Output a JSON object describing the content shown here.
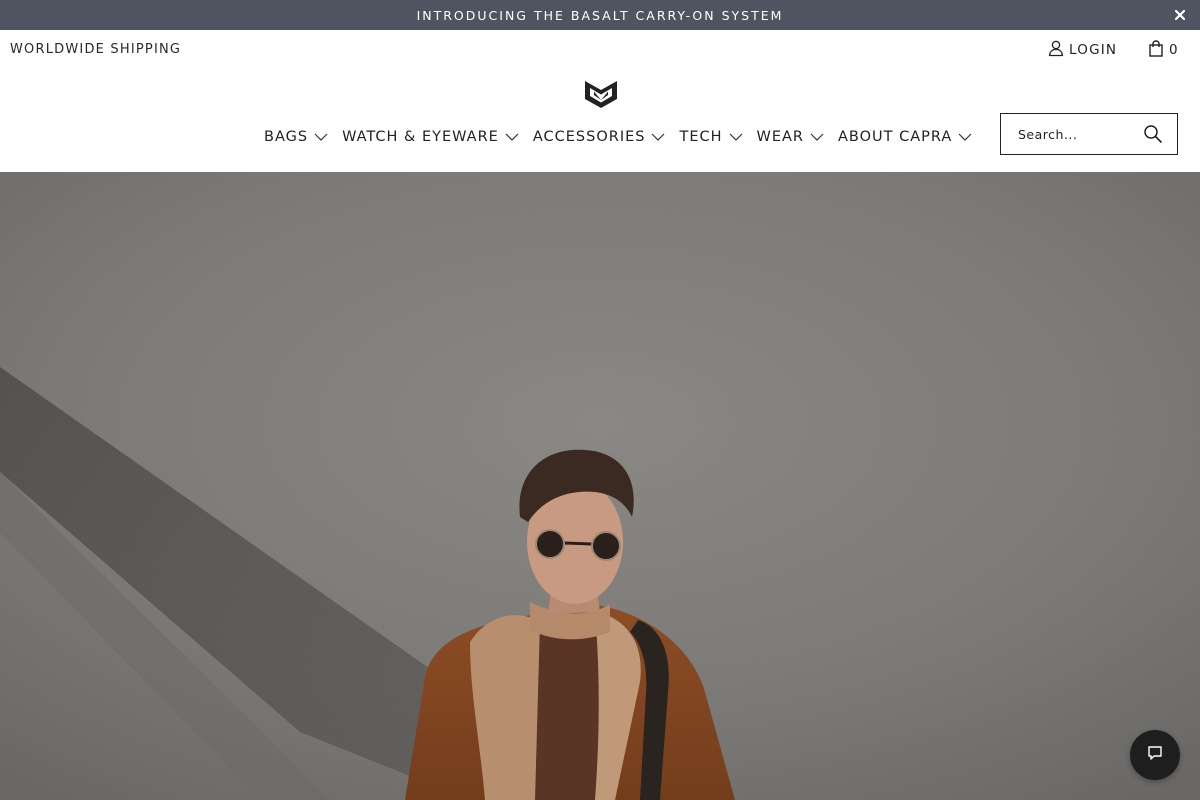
{
  "announcement": {
    "text": "INTRODUCING THE BASALT CARRY-ON SYSTEM",
    "close_icon": "close-icon",
    "background": "#4f5560"
  },
  "header": {
    "shipping_text": "WORLDWIDE SHIPPING",
    "login_label": "LOGIN",
    "login_icon": "user-icon",
    "cart_icon": "shopping-bag-icon",
    "cart_count": "0",
    "logo_icon": "capra-logo-icon"
  },
  "nav": {
    "items": [
      {
        "label": "BAGS"
      },
      {
        "label": "WATCH & EYEWARE"
      },
      {
        "label": "ACCESSORIES"
      },
      {
        "label": "TECH"
      },
      {
        "label": "WEAR"
      },
      {
        "label": "ABOUT CAPRA"
      }
    ],
    "chevron_icon": "chevron-down-icon"
  },
  "search": {
    "placeholder": "Search...",
    "value": "",
    "icon": "search-icon"
  },
  "hero": {
    "image": "man-with-sunglasses-scarf-backpack-photo",
    "background": "#7d7b78"
  },
  "chat": {
    "icon": "chat-icon",
    "background": "#1e1e1e"
  }
}
